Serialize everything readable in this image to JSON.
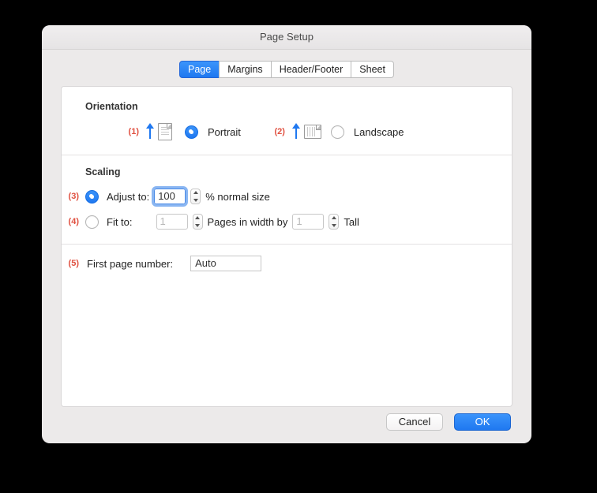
{
  "window": {
    "title": "Page Setup"
  },
  "tabs": [
    {
      "label": "Page",
      "active": true
    },
    {
      "label": "Margins",
      "active": false
    },
    {
      "label": "Header/Footer",
      "active": false
    },
    {
      "label": "Sheet",
      "active": false
    }
  ],
  "markers": {
    "m1": "(1)",
    "m2": "(2)",
    "m3": "(3)",
    "m4": "(4)",
    "m5": "(5)"
  },
  "orientation": {
    "section_label": "Orientation",
    "portrait_label": "Portrait",
    "landscape_label": "Landscape",
    "selected": "portrait"
  },
  "scaling": {
    "section_label": "Scaling",
    "adjust_label": "Adjust to:",
    "adjust_value": "100",
    "adjust_suffix": "% normal size",
    "fit_label": "Fit to:",
    "fit_width": "1",
    "fit_mid": "Pages in width by",
    "fit_height": "1",
    "fit_tall": "Tall",
    "selected": "adjust"
  },
  "first_page": {
    "label": "First page number:",
    "value": "Auto"
  },
  "buttons": {
    "cancel": "Cancel",
    "ok": "OK"
  }
}
